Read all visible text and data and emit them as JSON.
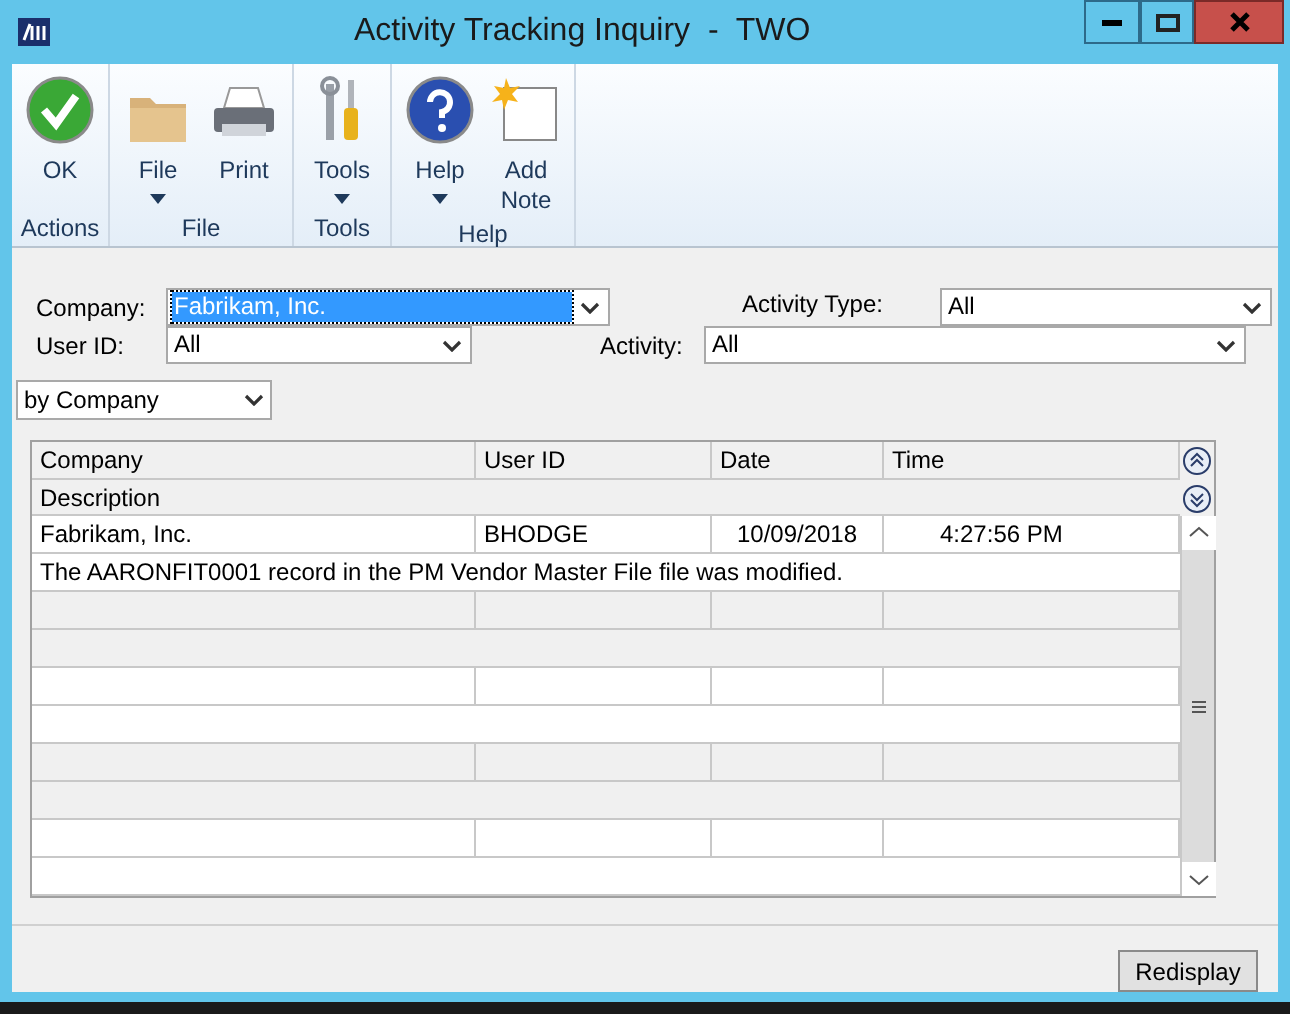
{
  "window": {
    "title": "Activity Tracking Inquiry  -  TWO"
  },
  "ribbon": [
    {
      "group": "Actions",
      "buttons": [
        {
          "kind": "ok",
          "label": "OK",
          "dropdown": false
        }
      ]
    },
    {
      "group": "File",
      "buttons": [
        {
          "kind": "folder",
          "label": "File",
          "dropdown": true
        },
        {
          "kind": "printer",
          "label": "Print",
          "dropdown": false
        }
      ]
    },
    {
      "group": "Tools",
      "buttons": [
        {
          "kind": "tools",
          "label": "Tools",
          "dropdown": true
        }
      ]
    },
    {
      "group": "Help",
      "buttons": [
        {
          "kind": "help",
          "label": "Help",
          "dropdown": true
        },
        {
          "kind": "note",
          "label": "Add Note",
          "dropdown": false
        }
      ]
    }
  ],
  "filters": {
    "company": {
      "label": "Company:",
      "value": "Fabrikam, Inc.",
      "highlighted": true
    },
    "user_id": {
      "label": "User ID:",
      "value": "All",
      "highlighted": false
    },
    "activity_type": {
      "label": "Activity Type:",
      "value": "All",
      "highlighted": false
    },
    "activity": {
      "label": "Activity:",
      "value": "All",
      "highlighted": false
    }
  },
  "sort_by": {
    "value": "by Company"
  },
  "table": {
    "columns": [
      "Company",
      "User ID",
      "Date",
      "Time"
    ],
    "description_column": "Description",
    "rows": [
      {
        "company": "Fabrikam, Inc.",
        "user_id": "BHODGE",
        "date": "10/09/2018",
        "time": "4:27:56 PM",
        "description": "The AARONFIT0001 record in the PM Vendor Master File file was modified."
      }
    ]
  },
  "buttons": [
    {
      "label": "Redisplay"
    }
  ]
}
